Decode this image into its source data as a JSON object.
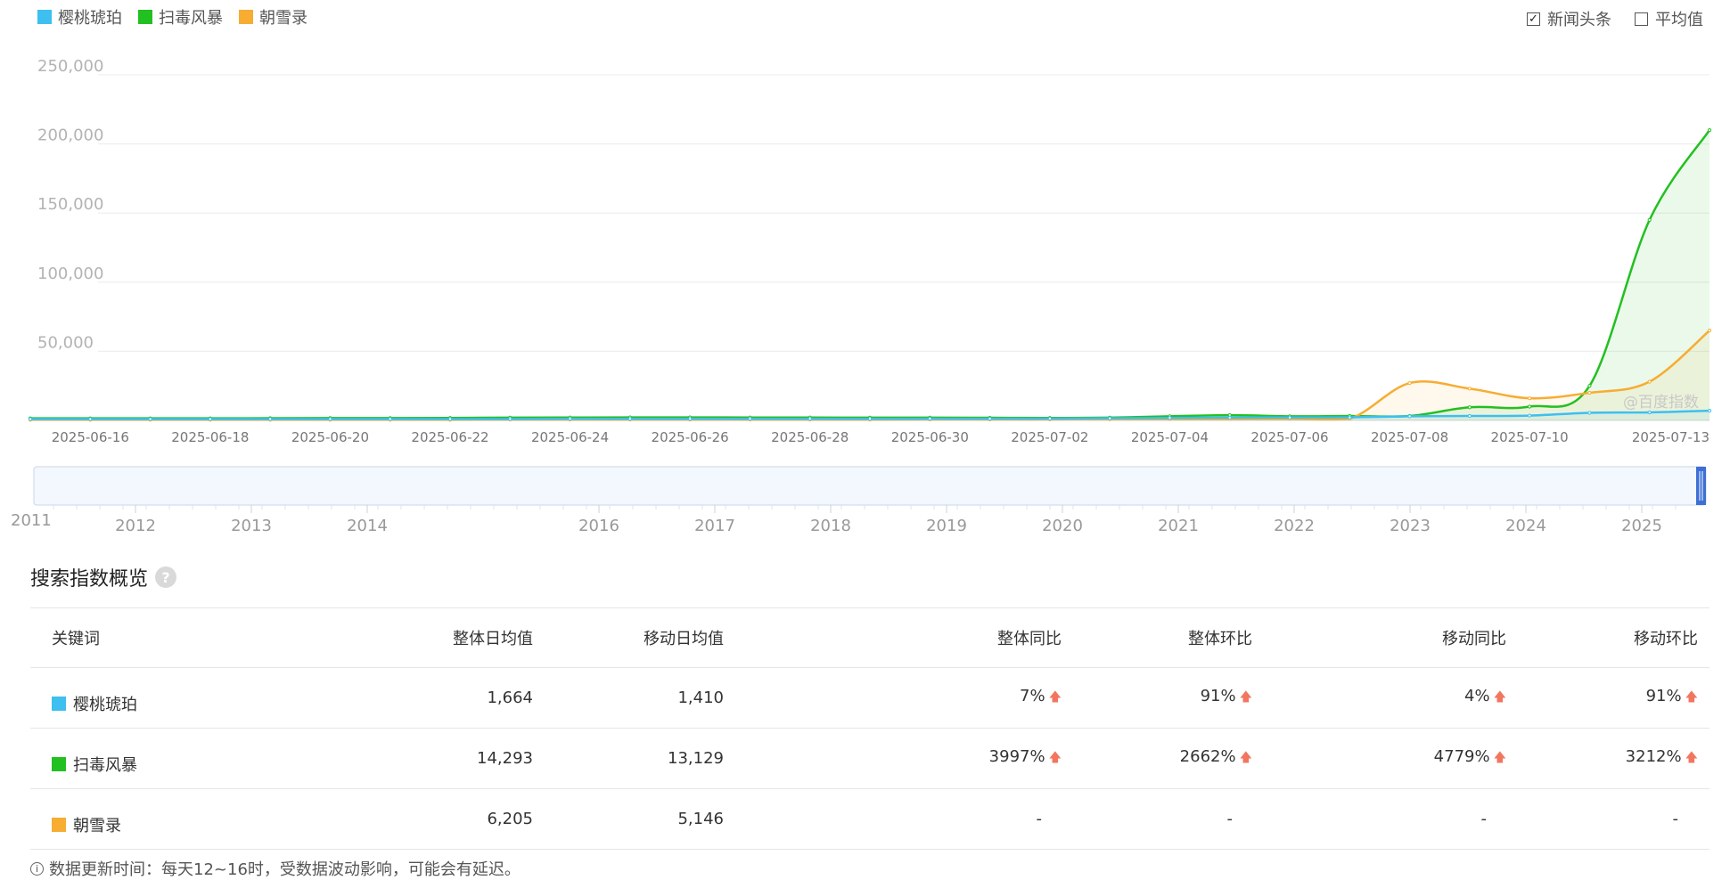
{
  "legend": [
    {
      "name": "樱桃琥珀",
      "color": "#3dbff0"
    },
    {
      "name": "扫毒风暴",
      "color": "#23c021"
    },
    {
      "name": "朝雪录",
      "color": "#f6ad32"
    }
  ],
  "options": {
    "news": "新闻头条",
    "news_checked": true,
    "avg": "平均值",
    "avg_checked": false
  },
  "watermark": "@百度指数",
  "chart_data": {
    "type": "line",
    "ylim": [
      0,
      250000
    ],
    "y_ticks": [
      50000,
      100000,
      150000,
      200000,
      250000
    ],
    "y_tick_labels": [
      "50,000",
      "100,000",
      "150,000",
      "200,000",
      "250,000"
    ],
    "x_tick_labels": [
      "2025-06-16",
      "2025-06-18",
      "2025-06-20",
      "2025-06-22",
      "2025-06-24",
      "2025-06-26",
      "2025-06-28",
      "2025-06-30",
      "2025-07-02",
      "2025-07-04",
      "2025-07-06",
      "2025-07-08",
      "2025-07-10",
      "2025-07-13"
    ],
    "x": [
      "2025-06-15",
      "2025-06-16",
      "2025-06-17",
      "2025-06-18",
      "2025-06-19",
      "2025-06-20",
      "2025-06-21",
      "2025-06-22",
      "2025-06-23",
      "2025-06-24",
      "2025-06-25",
      "2025-06-26",
      "2025-06-27",
      "2025-06-28",
      "2025-06-29",
      "2025-06-30",
      "2025-07-01",
      "2025-07-02",
      "2025-07-03",
      "2025-07-04",
      "2025-07-05",
      "2025-07-06",
      "2025-07-07",
      "2025-07-08",
      "2025-07-09",
      "2025-07-10",
      "2025-07-11",
      "2025-07-12",
      "2025-07-13"
    ],
    "series": [
      {
        "name": "樱桃琥珀",
        "color": "#3dbff0",
        "values": [
          1000,
          1000,
          1000,
          1000,
          1000,
          1000,
          1000,
          1000,
          1000,
          1100,
          1100,
          1100,
          1100,
          1100,
          1100,
          1200,
          1200,
          1300,
          1500,
          1800,
          2000,
          2100,
          2200,
          3000,
          3200,
          3500,
          5500,
          5800,
          7000
        ]
      },
      {
        "name": "扫毒风暴",
        "color": "#23c021",
        "values": [
          1500,
          1500,
          1500,
          1500,
          1600,
          1700,
          1700,
          1800,
          2000,
          2100,
          2200,
          2200,
          2100,
          2100,
          2000,
          2000,
          1900,
          1800,
          2000,
          3000,
          3800,
          3000,
          3200,
          3200,
          9500,
          10000,
          25000,
          145000,
          210000
        ]
      },
      {
        "name": "朝雪录",
        "color": "#f6ad32",
        "values": [
          500,
          500,
          500,
          500,
          500,
          500,
          500,
          500,
          600,
          600,
          600,
          600,
          600,
          600,
          600,
          700,
          700,
          800,
          900,
          1000,
          1000,
          1100,
          1200,
          27000,
          23000,
          16000,
          20000,
          28000,
          65000
        ]
      }
    ],
    "overview_years": [
      "2011",
      "2012",
      "2013",
      "2014",
      "2016",
      "2017",
      "2018",
      "2019",
      "2020",
      "2021",
      "2022",
      "2023",
      "2024",
      "2025"
    ]
  },
  "overview": {
    "title": "搜索指数概览",
    "help": "?",
    "columns": [
      "关键词",
      "整体日均值",
      "移动日均值",
      "整体同比",
      "整体环比",
      "移动同比",
      "移动环比"
    ],
    "rows": [
      {
        "keyword": "樱桃琥珀",
        "color": "#3dbff0",
        "overall_avg": "1,664",
        "mobile_avg": "1,410",
        "overall_yoy": "7%",
        "overall_qoq": "91%",
        "mobile_yoy": "4%",
        "mobile_qoq": "91%"
      },
      {
        "keyword": "扫毒风暴",
        "color": "#23c021",
        "overall_avg": "14,293",
        "mobile_avg": "13,129",
        "overall_yoy": "3997%",
        "overall_qoq": "2662%",
        "mobile_yoy": "4779%",
        "mobile_qoq": "3212%"
      },
      {
        "keyword": "朝雪录",
        "color": "#f6ad32",
        "overall_avg": "6,205",
        "mobile_avg": "5,146",
        "overall_yoy": "-",
        "overall_qoq": "-",
        "mobile_yoy": "-",
        "mobile_qoq": "-"
      }
    ]
  },
  "note": "数据更新时间：每天12~16时，受数据波动影响，可能会有延迟。"
}
